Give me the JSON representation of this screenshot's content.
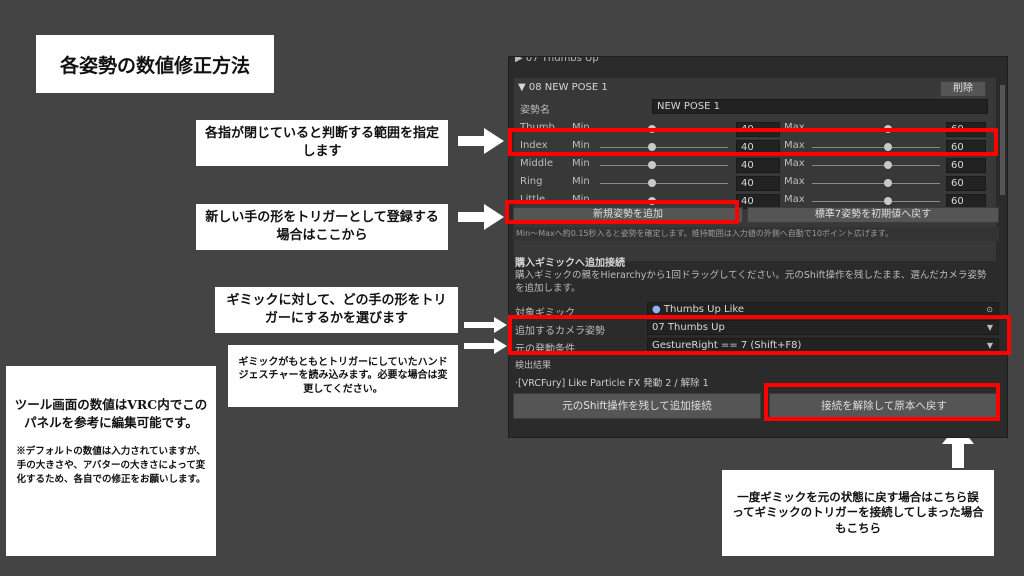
{
  "title": "各姿勢の数値修正方法",
  "notes": {
    "range": "各指が閉じていると判断する範囲を指定します",
    "add_pose": "新しい手の形をトリガーとして登録する場合はここから",
    "choose": "ギミックに対して、どの手の形をトリガーにするかを選びます",
    "gesture": "ギミックがもともとトリガーにしていたハンドジェスチャーを読み込みます。必要な場合は変更してください。",
    "tool_main": "ツール画面の数値はVRC内でこのパネルを参考に編集可能です。",
    "tool_sub": "※デフォルトの数値は入力されていますが、手の大きさや、アバターの大きさによって変化するため、各自での修正をお願いします。",
    "restore": "一度ギミックを元の状態に戻す場合はこちら誤ってギミックのトリガーを接続してしまった場合もこちら"
  },
  "panel": {
    "prev_item": "07 Thumbs Up",
    "pose_header": "08  NEW POSE 1",
    "delete_btn": "削除",
    "pose_name_label": "姿勢名",
    "pose_name_value": "NEW POSE 1",
    "min_label": "Min",
    "max_label": "Max",
    "fingers": [
      {
        "name": "Thumb",
        "min": "40",
        "max": "60"
      },
      {
        "name": "Index",
        "min": "40",
        "max": "60"
      },
      {
        "name": "Middle",
        "min": "40",
        "max": "60"
      },
      {
        "name": "Ring",
        "min": "40",
        "max": "60"
      },
      {
        "name": "Little",
        "min": "40",
        "max": "60"
      }
    ],
    "add_pose_btn": "新規姿勢を追加",
    "reset_btn": "標準7姿勢を初期値へ戻す",
    "hint": "Min〜Maxへ約0.15秒入ると姿勢を確定します。維持範囲は入力値の外側へ自動で10ポイント広げます。",
    "section_title": "購入ギミックへ追加接続",
    "section_desc": "購入ギミックの親をHierarchyから1回ドラッグしてください。元のShift操作を残したまま、選んだカメラ姿勢を追加します。",
    "target_label": "対象ギミック",
    "target_value": "Thumbs Up Like",
    "camera_label": "追加するカメラ姿勢",
    "camera_value": "07  Thumbs Up",
    "cond_label": "元の発動条件",
    "cond_value": "GestureRight == 7 (Shift+F8)",
    "result_title": "検出結果",
    "result_line": "·[VRCFury] Like Particle FX  発動 2 / 解除 1",
    "connect_btn": "元のShift操作を残して追加接続",
    "restore_btn": "接続を解除して原本へ戻す"
  },
  "colors": {
    "highlight": "#ff0000",
    "background": "#444444",
    "panel": "#2b2b2b"
  }
}
